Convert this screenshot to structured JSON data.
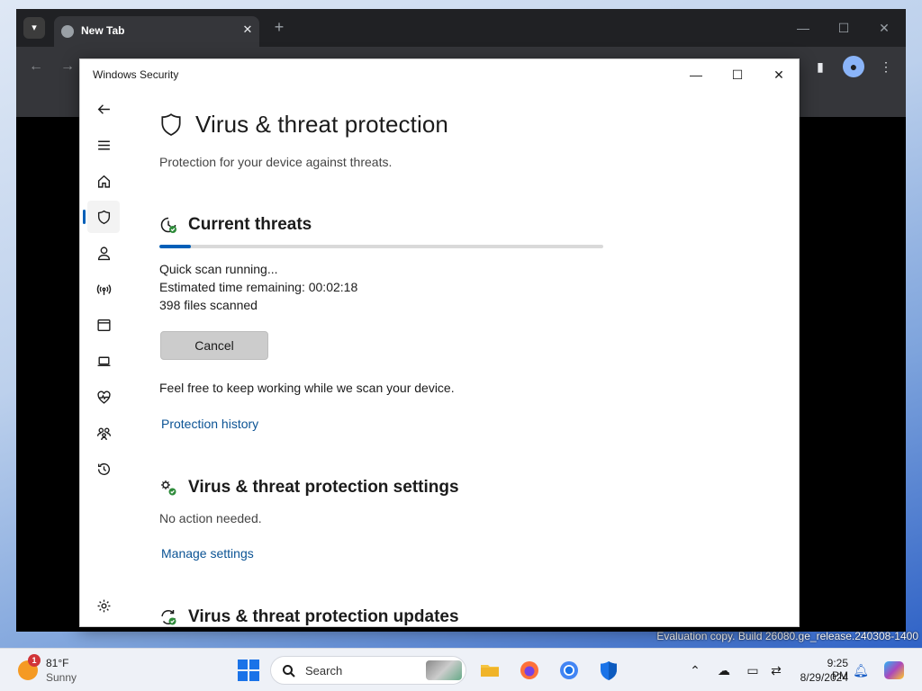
{
  "browser": {
    "tab_title": "New Tab",
    "tab_close": "✕",
    "new_tab": "+",
    "minimize": "—",
    "maximize": "☐",
    "close": "✕",
    "back": "←",
    "forward": "→"
  },
  "window": {
    "title": "Windows Security",
    "minimize": "—",
    "maximize": "☐",
    "close": "✕"
  },
  "sidebar": {
    "items": [
      {
        "name": "back-icon",
        "active": false
      },
      {
        "name": "menu-icon",
        "active": false
      },
      {
        "name": "home-icon",
        "active": false
      },
      {
        "name": "shield-icon",
        "active": true
      },
      {
        "name": "account-icon",
        "active": false
      },
      {
        "name": "network-icon",
        "active": false
      },
      {
        "name": "app-browser-icon",
        "active": false
      },
      {
        "name": "device-security-icon",
        "active": false
      },
      {
        "name": "health-icon",
        "active": false
      },
      {
        "name": "family-icon",
        "active": false
      },
      {
        "name": "history-icon",
        "active": false
      },
      {
        "name": "settings-icon",
        "active": false
      }
    ]
  },
  "page": {
    "title": "Virus & threat protection",
    "subtitle": "Protection for your device against threats."
  },
  "current_threats": {
    "title": "Current threats",
    "progress": 0.07,
    "status": "Quick scan running...",
    "time_label": "Estimated time remaining:",
    "time_value": "00:02:18",
    "files_count": "398",
    "files_label": "files scanned",
    "cancel_label": "Cancel",
    "note": "Feel free to keep working while we scan your device.",
    "history_link": "Protection history"
  },
  "settings_section": {
    "title": "Virus & threat protection settings",
    "status": "No action needed.",
    "link": "Manage settings"
  },
  "updates_section": {
    "title": "Virus & threat protection updates"
  },
  "desktop": {
    "watermark": "Evaluation copy. Build 26080.ge_release.240308-1400"
  },
  "taskbar": {
    "weather_badge": "1",
    "weather_temp": "81°F",
    "weather_condition": "Sunny",
    "search_placeholder": "Search",
    "clock_time": "9:25 PM",
    "clock_date": "8/29/2024",
    "apps": [
      "file-explorer-icon",
      "firefox-icon",
      "chrome-icon",
      "windows-security-icon"
    ],
    "accent": "#005fb8"
  }
}
